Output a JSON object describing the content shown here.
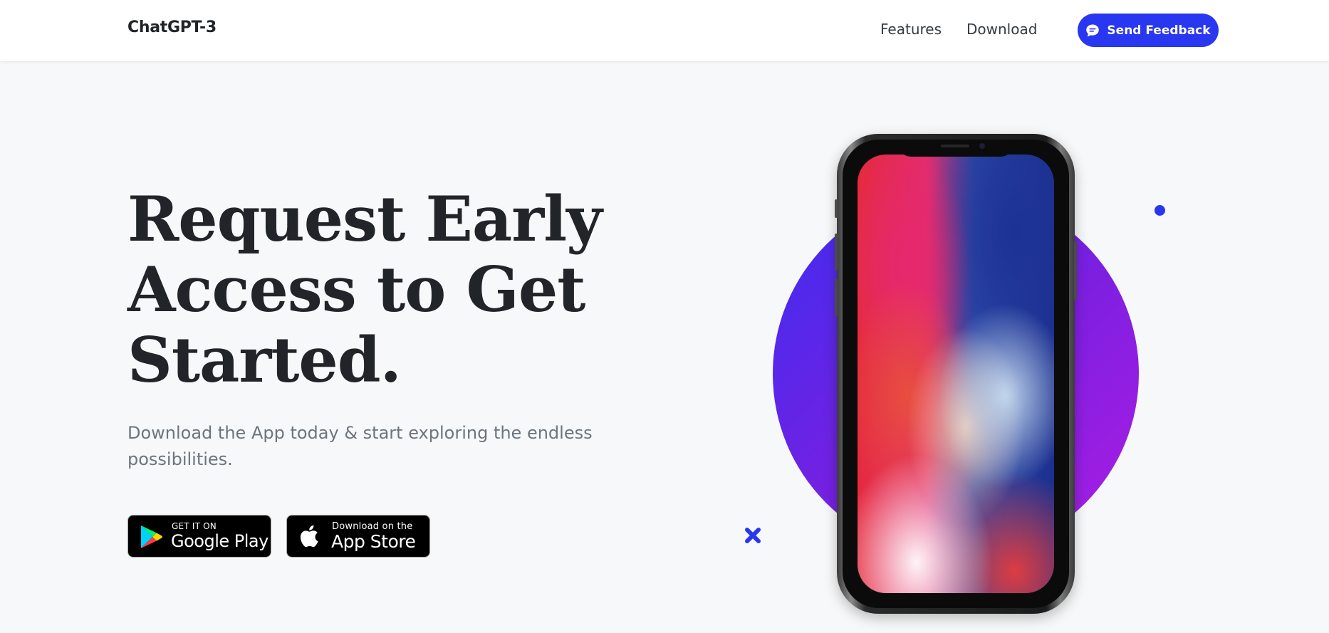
{
  "navbar": {
    "brand": "ChatGPT-3",
    "links": [
      {
        "label": "Features"
      },
      {
        "label": "Download"
      }
    ],
    "feedback_button": {
      "label": "Send Feedback",
      "icon": "chat-bubble-icon"
    }
  },
  "masthead": {
    "title": "Request Early Access to Get Started.",
    "subtitle": "Download the App today & start exploring the endless possibilities."
  },
  "badges": {
    "google": {
      "small": "GET IT ON",
      "big": "Google Play",
      "icon": "google-play-icon"
    },
    "apple": {
      "small": "Download on the",
      "big": "App Store",
      "icon": "apple-icon"
    }
  },
  "colors": {
    "accent": "#2937f0",
    "circle_start": "#3d2df0",
    "circle_end": "#ad1ee4",
    "page_bg": "#f7f8f9"
  }
}
